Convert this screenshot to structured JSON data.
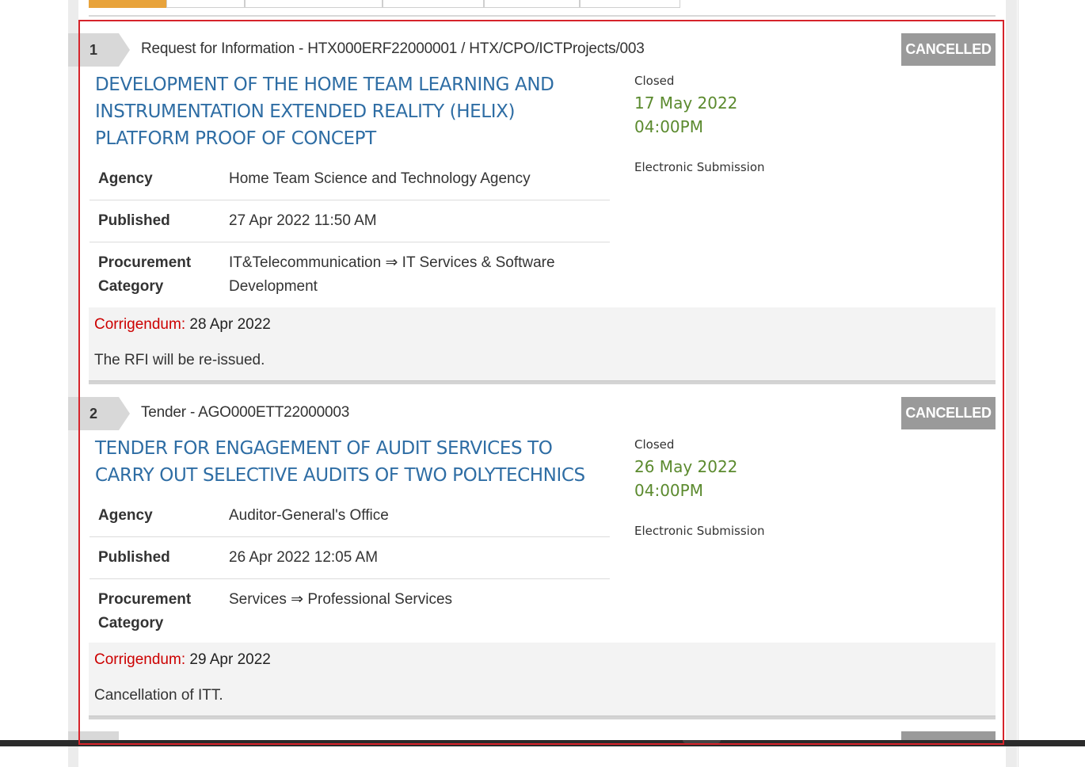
{
  "listings": [
    {
      "number": "1",
      "reference": "Request for Information - HTX000ERF22000001 / HTX/CPO/ICTProjects/003",
      "status": "CANCELLED",
      "title": "DEVELOPMENT OF THE HOME TEAM LEARNING AND INSTRUMENTATION EXTENDED REALITY (HELIX) PLATFORM PROOF OF CONCEPT",
      "closed_label": "Closed",
      "closing_date": "17 May 2022",
      "closing_time": "04:00PM",
      "submission": "Electronic Submission",
      "agency_label": "Agency",
      "agency": "Home Team Science and Technology Agency",
      "published_label": "Published",
      "published": "27 Apr 2022 11:50 AM",
      "category_label": "Procurement Category",
      "category": "IT&Telecommunication ⇒ IT Services & Software Development",
      "corrigendum_label": "Corrigendum:",
      "corrigendum_date": "28 Apr 2022",
      "corrigendum_text": "The RFI will be re-issued."
    },
    {
      "number": "2",
      "reference": "Tender - AGO000ETT22000003",
      "status": "CANCELLED",
      "title": "TENDER FOR ENGAGEMENT OF AUDIT SERVICES TO CARRY OUT SELECTIVE AUDITS OF TWO POLYTECHNICS",
      "closed_label": "Closed",
      "closing_date": "26 May 2022",
      "closing_time": "04:00PM",
      "submission": "Electronic Submission",
      "agency_label": "Agency",
      "agency": "Auditor-General's Office",
      "published_label": "Published",
      "published": "26 Apr 2022 12:05 AM",
      "category_label": "Procurement Category",
      "category": "Services ⇒ Professional Services",
      "corrigendum_label": "Corrigendum:",
      "corrigendum_date": "29 Apr 2022",
      "corrigendum_text": "Cancellation of ITT."
    }
  ],
  "colors": {
    "title": "#2e6da4",
    "closing": "#5b8a2e",
    "corrigendum_label": "#cc0000",
    "status_badge": "#9a9a9a",
    "highlight_outline": "#d6242b",
    "active_tab": "#e8a33b"
  }
}
